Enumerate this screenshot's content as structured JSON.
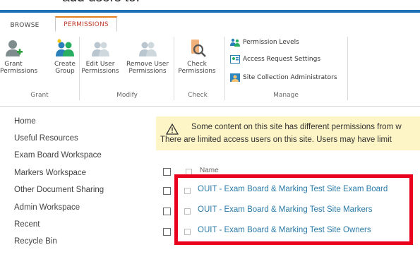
{
  "caption": "add users to:",
  "tabs": {
    "browse": "BROWSE",
    "permissions": "PERMISSIONS"
  },
  "ribbon": {
    "grant_permissions": "Grant Permissions",
    "create_group": "Create Group",
    "edit_user_permissions": "Edit User Permissions",
    "remove_user_permissions": "Remove User Permissions",
    "check_permissions": "Check Permissions",
    "permission_levels": "Permission Levels",
    "access_request_settings": "Access Request Settings",
    "site_collection_administrators": "Site Collection Administrators",
    "groups": {
      "grant": "Grant",
      "modify": "Modify",
      "check": "Check",
      "manage": "Manage"
    }
  },
  "nav": [
    "Home",
    "Useful Resources",
    "Exam Board Workspace",
    "Markers Workspace",
    "Other Document Sharing",
    "Admin Workspace",
    "Recent",
    "Recycle Bin"
  ],
  "warning": {
    "line1": "Some content on this site has different permissions from w",
    "line2": "There are limited access users on this site. Users may have limit"
  },
  "list": {
    "column_name": "Name",
    "rows": [
      "OUIT - Exam Board & Marking Test Site Exam Board",
      "OUIT - Exam Board & Marking Test Site Markers",
      "OUIT - Exam Board & Marking Test Site Owners"
    ]
  },
  "colors": {
    "accent": "#1d6fb8",
    "link": "#2a7aa8",
    "highlight": "#e8001c",
    "warning_bg": "#fdf5c6"
  }
}
